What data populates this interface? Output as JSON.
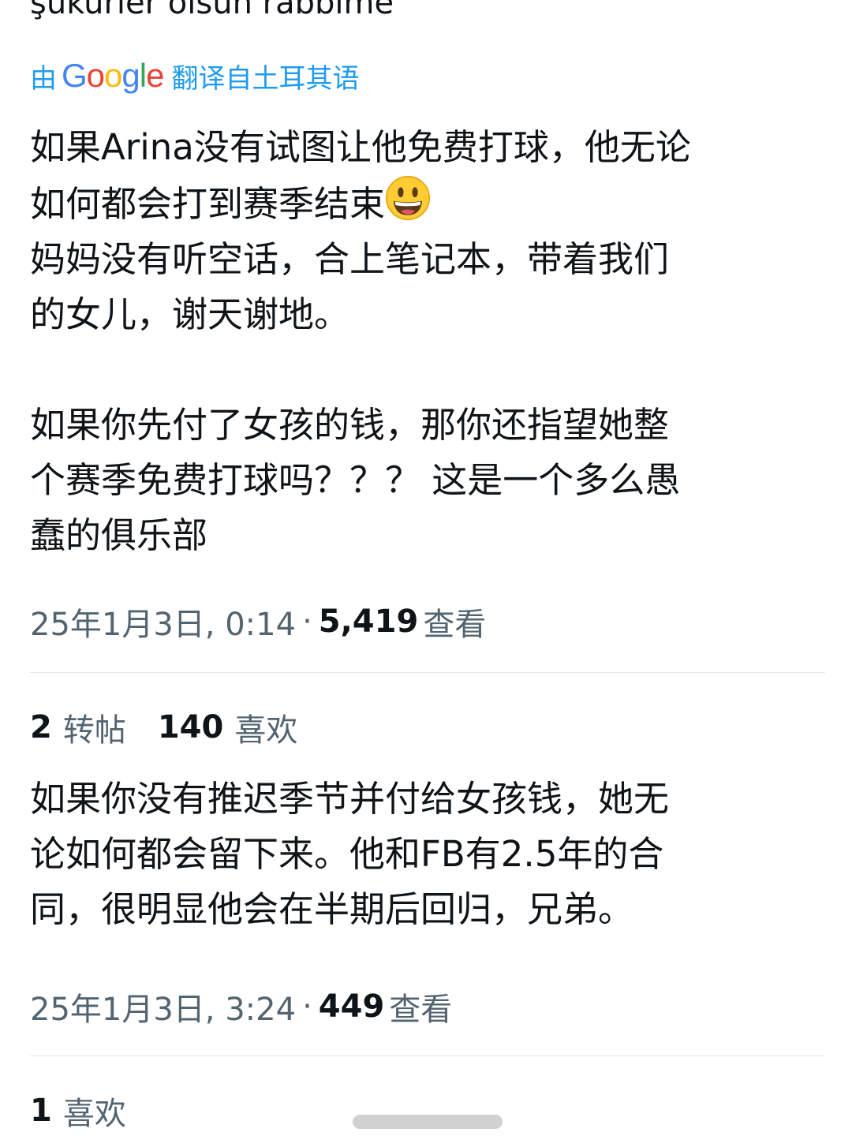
{
  "original_snippet": "şükürler olsun rabbime",
  "translation_bar": {
    "prefix": "由",
    "google_letters": [
      "G",
      "o",
      "o",
      "g",
      "l",
      "e"
    ],
    "google_colors": [
      "#4285F4",
      "#EA4335",
      "#FBBC05",
      "#4285F4",
      "#34A853",
      "#EA4335"
    ],
    "suffix": "翻译自土耳其语",
    "color": "#1d9bf0"
  },
  "tweet1": {
    "para1_line1": "如果Arina没有试图让他免费打球，他无论",
    "para1_line2": "如何都会打到赛季结束",
    "emoji": "grinning-face-emoji",
    "para1_line3": "妈妈没有听空话，合上笔记本，带着我们",
    "para1_line4": "的女儿，谢天谢地。",
    "para2_line1": "如果你先付了女孩的钱，那你还指望她整",
    "para2_line2": "个赛季免费打球吗？？？ 这是一个多么愚",
    "para2_line3": "蠢的俱乐部",
    "timestamp": "25年1月3日, 0:14",
    "separator": "·",
    "views_count": "5,419",
    "views_label": "查看",
    "reposts_count": "2",
    "reposts_label": "转帖",
    "likes_count": "140",
    "likes_label": "喜欢"
  },
  "tweet2": {
    "line1": "如果你没有推迟季节并付给女孩钱，她无",
    "line2": "论如何都会留下来。他和FB有2.5年的合",
    "line3": "同，很明显他会在半期后回归，兄弟。",
    "timestamp": "25年1月3日, 3:24",
    "separator": "·",
    "views_count": "449",
    "views_label": "查看",
    "likes_count": "1",
    "likes_label": "喜欢"
  }
}
